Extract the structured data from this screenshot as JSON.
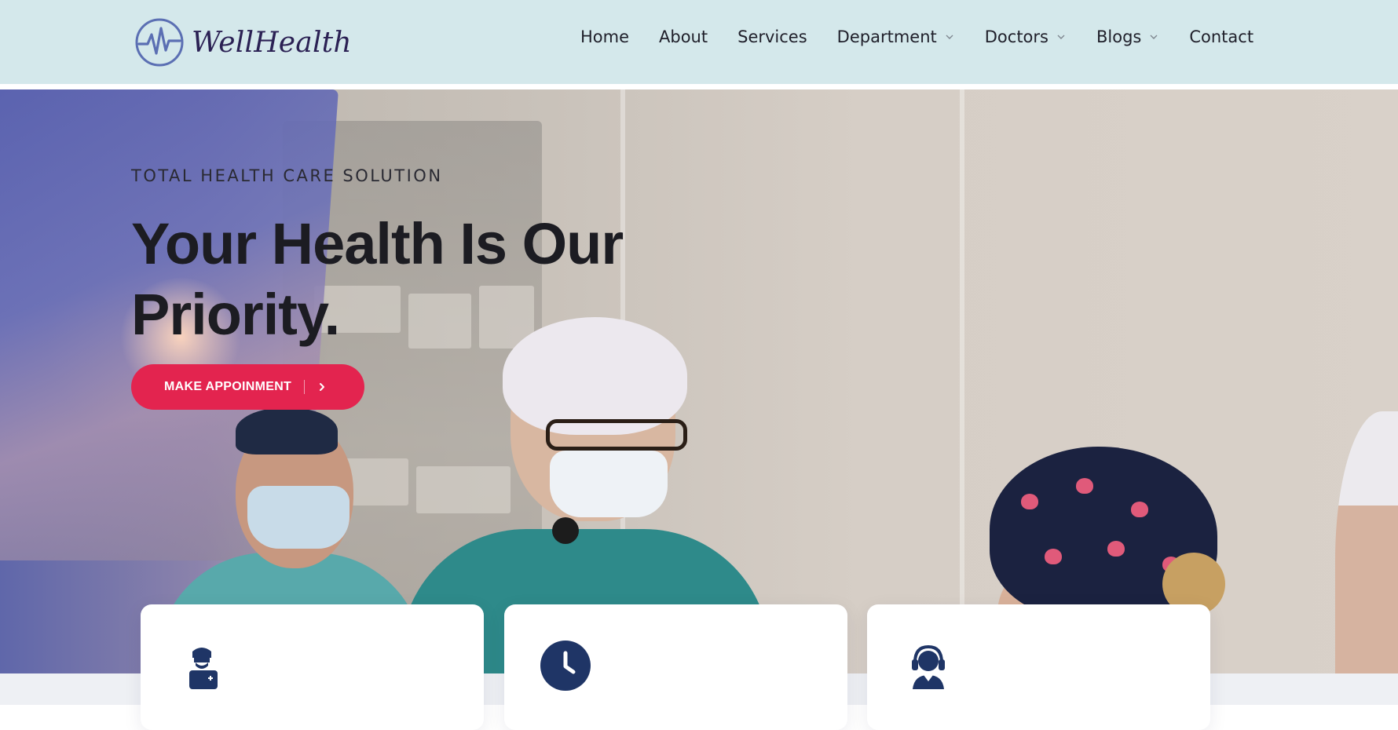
{
  "brand": {
    "name": "WellHealth",
    "color": "#2b2154",
    "accent": "#5b6fb3"
  },
  "nav": {
    "items": [
      {
        "label": "Home",
        "has_dropdown": false
      },
      {
        "label": "About",
        "has_dropdown": false
      },
      {
        "label": "Services",
        "has_dropdown": false
      },
      {
        "label": "Department",
        "has_dropdown": true
      },
      {
        "label": "Doctors",
        "has_dropdown": true
      },
      {
        "label": "Blogs",
        "has_dropdown": true
      },
      {
        "label": "Contact",
        "has_dropdown": false
      }
    ]
  },
  "hero": {
    "kicker": "TOTAL HEALTH CARE SOLUTION",
    "title": "Your Health Is Our Priority.",
    "cta_label": "MAKE APPOINMENT",
    "cta_color": "#e3244f"
  },
  "cards": [
    {
      "icon": "doctor-icon"
    },
    {
      "icon": "clock-icon"
    },
    {
      "icon": "support-agent-icon"
    }
  ],
  "colors": {
    "header_bg": "#d4e8eb",
    "icon_navy": "#1f3566"
  }
}
